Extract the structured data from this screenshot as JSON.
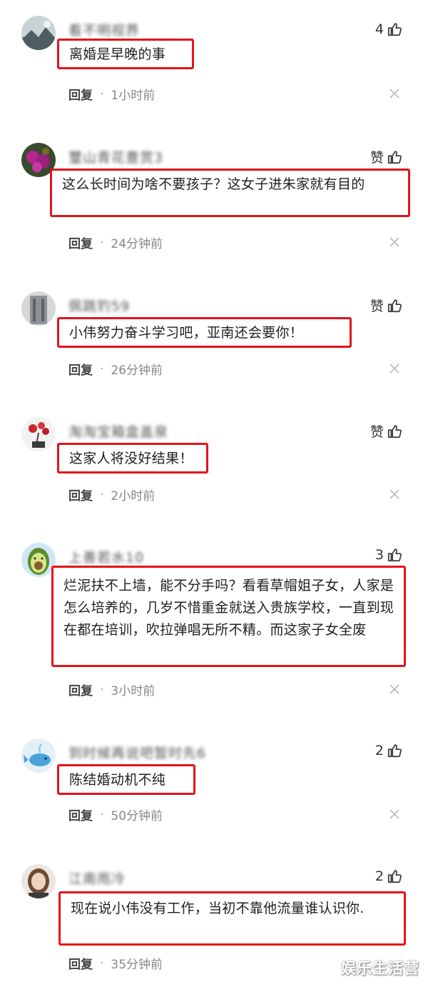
{
  "reply_label": "回复",
  "separator": "·",
  "watermark": "娱乐生活营",
  "comments": [
    {
      "username": "看不明视界",
      "like": "4",
      "text": "离婚是早晚的事",
      "time": "1小时前",
      "avatar_icon": "avatar-landscape-icon"
    },
    {
      "username": "璽山青花豊赏3",
      "like": "赞",
      "text": "这么长时间为啥不要孩子？这女子进朱家就有目的",
      "time": "24分钟前",
      "avatar_icon": "avatar-flower-icon"
    },
    {
      "username": "佩跳钓59",
      "like": "赞",
      "text": "小伟努力奋斗学习吧，亚南还会要你！",
      "time": "26分钟前",
      "avatar_icon": "avatar-building-icon"
    },
    {
      "username": "淘淘宝箱盒盖泉",
      "like": "赞",
      "text": "这家人将没好结果！",
      "time": "2小时前",
      "avatar_icon": "avatar-bonsai-icon"
    },
    {
      "username": "上善若水10",
      "like": "3",
      "text": "烂泥扶不上墙，能不分手吗？看看草帽姐子女，人家是怎么培养的，几岁不惜重金就送入贵族学校，一直到现在都在培训，吹拉弹唱无所不精。而这家子女全废",
      "time": "3小时前",
      "avatar_icon": "avatar-avocado-icon"
    },
    {
      "username": "到时候再说吧暂时先6",
      "like": "2",
      "text": "陈结婚动机不纯",
      "time": "50分钟前",
      "avatar_icon": "avatar-whale-icon"
    },
    {
      "username": "江南雨冷",
      "like": "2",
      "text": "现在说小伟没有工作，当初不靠他流量谁认识你.",
      "time": "35分钟前",
      "avatar_icon": "avatar-woman-icon"
    }
  ]
}
